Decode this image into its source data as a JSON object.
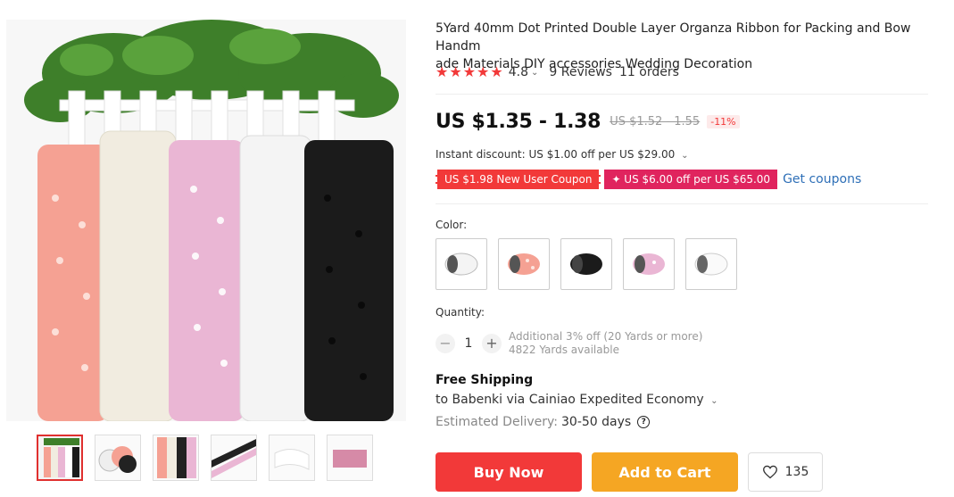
{
  "product": {
    "title": "5Yard 40mm Dot Printed Double Layer Organza Ribbon for Packing and Bow Handmade Materials DIY accessories Wedding Decoration",
    "title_line1": "5Yard 40mm Dot Printed Double Layer Organza Ribbon for Packing and Bow Handm",
    "title_line2": "ade Materials DIY accessories Wedding Decoration",
    "rating": "4.8",
    "reviews": "9 Reviews",
    "orders": "11 orders",
    "stars": 5
  },
  "price": {
    "current": "US $1.35 - 1.38",
    "original": "US $1.52 - 1.55",
    "discount": "-11%",
    "instant_discount": "Instant discount: US $1.00 off per US $29.00"
  },
  "coupons": {
    "new_user": "US $1.98 New User Coupon",
    "store": "✦ US $6.00 off per US $65.00",
    "get_link": "Get coupons"
  },
  "color": {
    "label": "Color:",
    "options": [
      "white",
      "pink-dot",
      "black",
      "light-pink",
      "white-dot"
    ]
  },
  "quantity": {
    "label": "Quantity:",
    "value": "1",
    "minus": "−",
    "plus": "+",
    "note": "Additional 3% off (20 Yards or more)",
    "available": "4822 Yards available"
  },
  "shipping": {
    "title": "Free Shipping",
    "detail": "to Babenki via Cainiao Expedited Economy",
    "delivery_label": "Estimated Delivery:",
    "delivery_days": "30-50 days"
  },
  "actions": {
    "buy_now": "Buy Now",
    "add_to_cart": "Add to Cart",
    "wishlist_count": "135"
  },
  "colors": {
    "accent_red": "#f23939",
    "cart_orange": "#f5a623",
    "coupon_pink": "#e0245e",
    "link_blue": "#2e6fb7"
  }
}
